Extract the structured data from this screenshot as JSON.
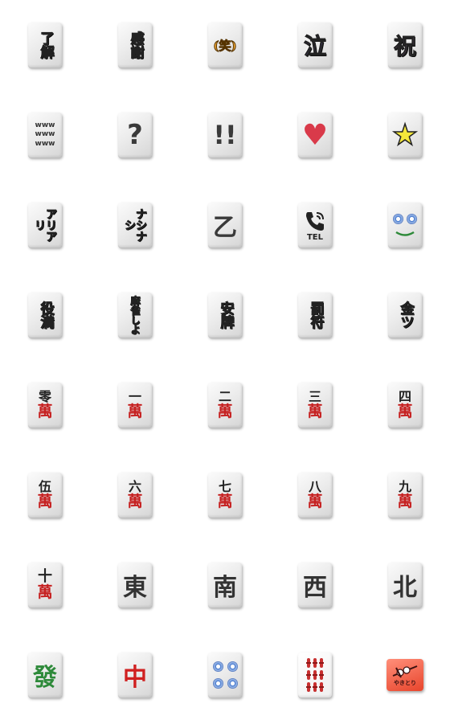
{
  "row1": [
    "了解",
    "感謝",
    "㊦",
    "泣",
    "祝"
  ],
  "row1_labels": [
    "了解",
    "感謝",
    "(笑)",
    "泣",
    "祝"
  ],
  "row2": {
    "www": "www",
    "question": "?",
    "exclaim": "!!",
    "heart": "♥",
    "star": "★"
  },
  "row3": {
    "ari": "アリアリ",
    "nashi": "ナシナシ",
    "otsu": "乙",
    "tel": "TEL"
  },
  "row4": [
    "役満",
    "麻雀しよ",
    "安牌",
    "罰符",
    "金ツ"
  ],
  "manzu_bottom": "萬",
  "row5": [
    "零",
    "一",
    "二",
    "三",
    "四"
  ],
  "row6": [
    "伍",
    "六",
    "七",
    "八",
    "九"
  ],
  "row7": {
    "ten": "十",
    "east": "東",
    "south": "南",
    "west": "西",
    "north": "北"
  },
  "row8": {
    "hatsu": "發",
    "chun": "中",
    "yakitori": "やきとり"
  },
  "colors": {
    "ryokai_top": "#e8502a",
    "kansha": "#d8c83a",
    "warai": "#e8a030",
    "naki": "#7a5cc8",
    "iwai": "#c880d0",
    "heart": "#d93a4a",
    "star": "#f5e83a",
    "ari": "#b040d8",
    "nashi": "#3a7ad8",
    "yakuman": "#f0e04a",
    "mahjong_shiyo": "#40c040",
    "anpai": "#e03a3a",
    "bappu": "#40c0a8",
    "kinntsu": "#e84020",
    "manzu_red": "#c62020",
    "hatsu": "#2e8a3a",
    "chun": "#d02020"
  }
}
